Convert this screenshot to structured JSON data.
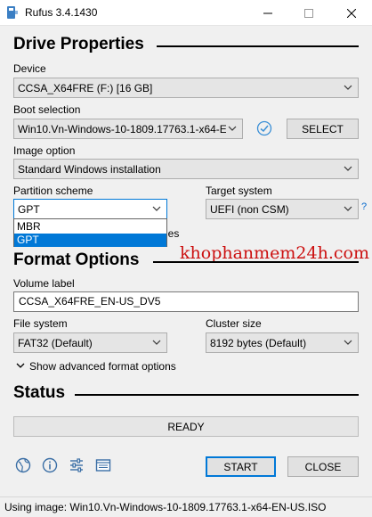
{
  "window": {
    "title": "Rufus 3.4.1430",
    "minimize_glyph": "—",
    "maximize_glyph": "☐",
    "close_glyph": "✕"
  },
  "drive_properties": {
    "heading": "Drive Properties",
    "device": {
      "label": "Device",
      "value": "CCSA_X64FRE (F:) [16 GB]"
    },
    "boot_selection": {
      "label": "Boot selection",
      "value": "Win10.Vn-Windows-10-1809.17763.1-x64-EN",
      "select_button": "SELECT",
      "verify_icon": "check-circle-icon"
    },
    "image_option": {
      "label": "Image option",
      "value": "Standard Windows installation"
    },
    "partition_scheme": {
      "label": "Partition scheme",
      "value": "GPT",
      "options": [
        "MBR",
        "GPT"
      ],
      "selected": "GPT"
    },
    "target_system": {
      "label": "Target system",
      "value": "UEFI (non CSM)",
      "help": "?"
    },
    "hidden_text_fragment": "ies"
  },
  "format_options": {
    "heading": "Format Options",
    "volume_label": {
      "label": "Volume label",
      "value": "CCSA_X64FRE_EN-US_DV5"
    },
    "file_system": {
      "label": "File system",
      "value": "FAT32 (Default)"
    },
    "cluster_size": {
      "label": "Cluster size",
      "value": "8192 bytes (Default)"
    },
    "advanced_toggle": "Show advanced format options"
  },
  "status": {
    "heading": "Status",
    "progress_text": "READY"
  },
  "toolbar": {
    "icons": [
      "globe-icon",
      "info-icon",
      "settings-sliders-icon",
      "log-icon"
    ],
    "start": "START",
    "close": "CLOSE"
  },
  "statusbar": {
    "text": "Using image: Win10.Vn-Windows-10-1809.17763.1-x64-EN-US.ISO"
  },
  "watermark": {
    "text": "khophanmem24h.com",
    "color": "#cc1010"
  },
  "colors": {
    "accent": "#0078d7",
    "window_bg": "#f0f0f0"
  }
}
